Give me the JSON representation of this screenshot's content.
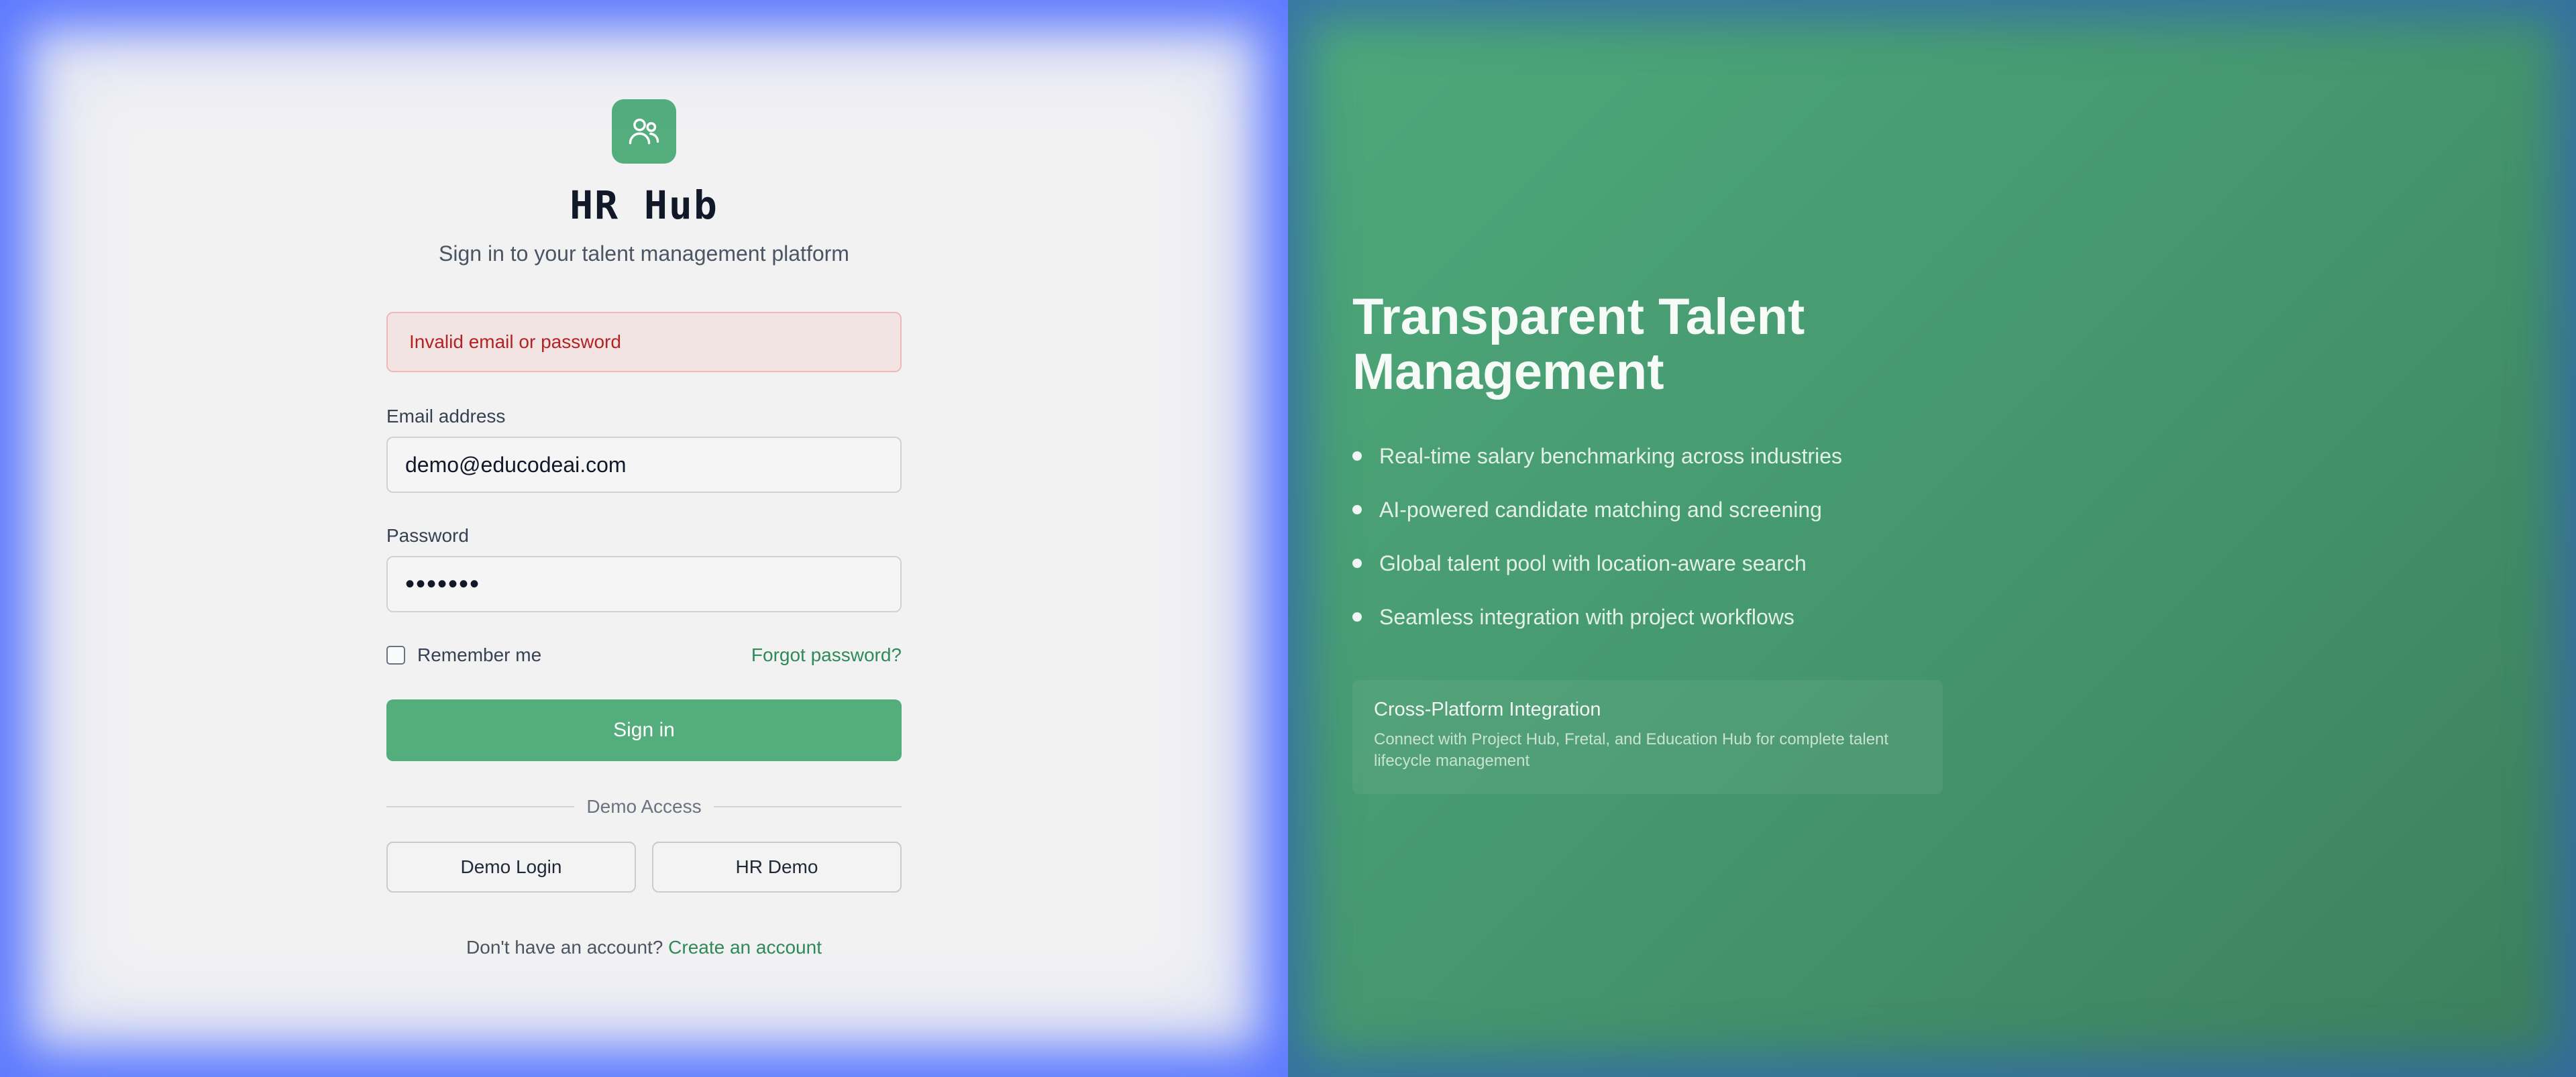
{
  "app": {
    "title": "HR Hub",
    "subtitle": "Sign in to your talent management platform",
    "logo_icon": "users-icon",
    "brand_color": "#53ad7d"
  },
  "form": {
    "error_message": "Invalid email or password",
    "email_label": "Email address",
    "email_value": "demo@educodeai.com",
    "password_label": "Password",
    "password_value": "•••••••",
    "remember_label": "Remember me",
    "remember_checked": false,
    "forgot_label": "Forgot password?",
    "submit_label": "Sign in",
    "divider_label": "Demo Access",
    "demo_buttons": [
      "Demo Login",
      "HR Demo"
    ],
    "signup_prompt": "Don't have an account?",
    "signup_link": "Create an account"
  },
  "hero": {
    "title": "Transparent Talent Management",
    "features": [
      "Real-time salary benchmarking across industries",
      "AI-powered candidate matching and screening",
      "Global talent pool with location-aware search",
      "Seamless integration with project workflows"
    ],
    "card_title": "Cross-Platform Integration",
    "card_description": "Connect with Project Hub, Fretal, and Education Hub for complete talent lifecycle management"
  },
  "colors": {
    "error_text": "#b42222",
    "link": "#2e8a58",
    "panel_green": "#46996f"
  }
}
